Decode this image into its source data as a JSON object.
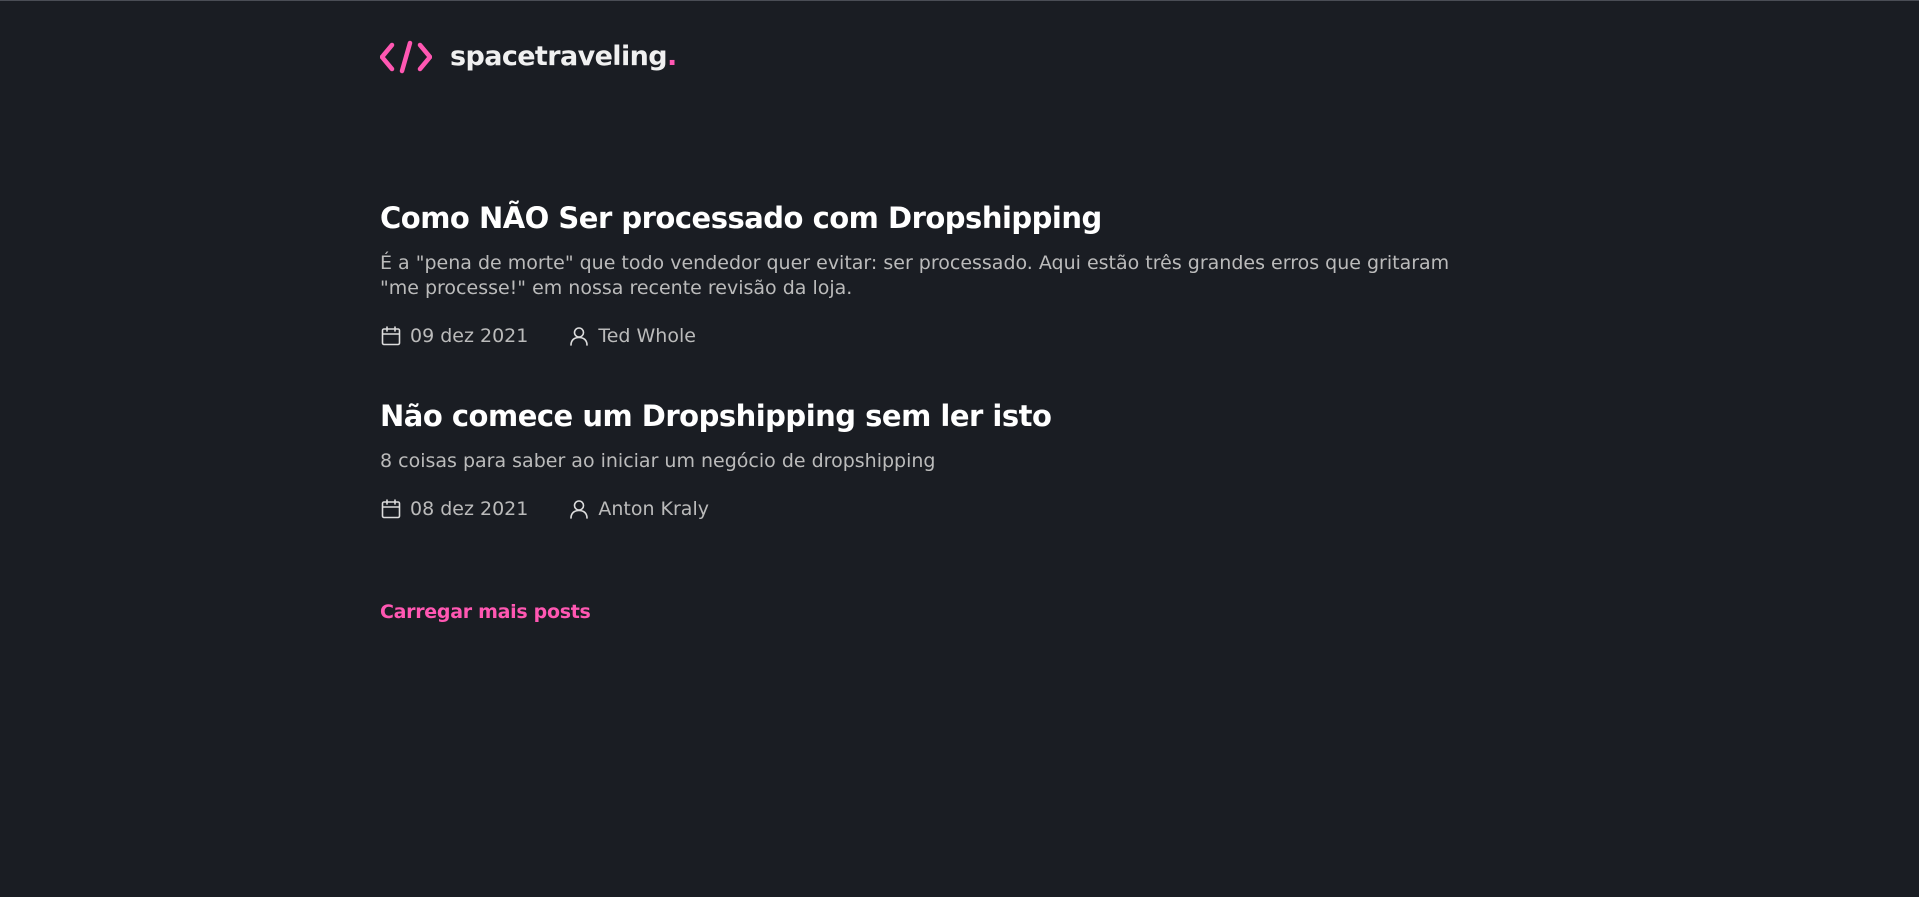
{
  "header": {
    "logo_icon": "code-brackets-icon",
    "brand_name": "spacetraveling",
    "brand_dot": ".",
    "accent_color": "#ff57b2"
  },
  "posts": [
    {
      "title": "Como NÃO Ser processado com Dropshipping",
      "subtitle": "É a \"pena de morte\" que todo vendedor quer evitar: ser processado. Aqui estão três grandes erros que gritaram \"me processe!\" em nossa recente revisão da loja.",
      "date": "09 dez 2021",
      "author": "Ted Whole"
    },
    {
      "title": "Não comece um Dropshipping sem ler isto",
      "subtitle": "8 coisas para saber ao iniciar um negócio de dropshipping",
      "date": "08 dez 2021",
      "author": "Anton Kraly"
    }
  ],
  "load_more_label": "Carregar mais posts",
  "colors": {
    "background": "#1a1d23",
    "title": "#ffffff",
    "body_text": "#bbbbbb",
    "accent": "#ff57b2"
  }
}
